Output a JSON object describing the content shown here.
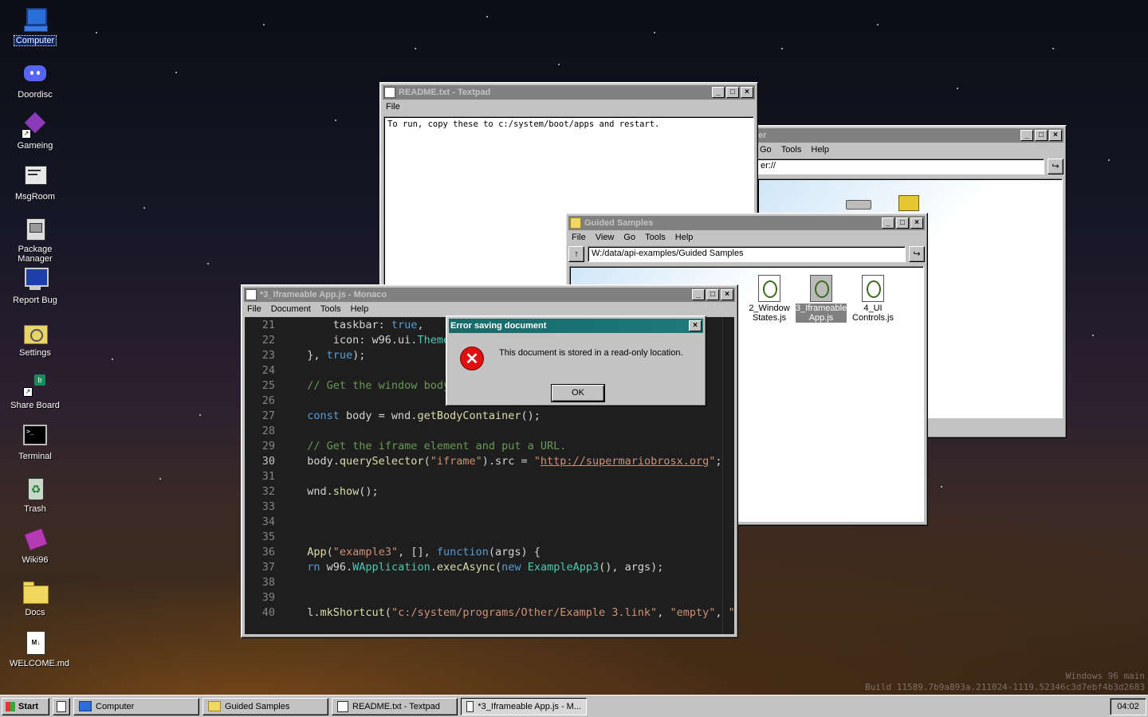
{
  "desktop": {
    "icons": [
      {
        "label": "Computer",
        "icon": "computer-icon"
      },
      {
        "label": "Doordisc",
        "icon": "discord-icon"
      },
      {
        "label": "Gameing",
        "icon": "game-cube-icon"
      },
      {
        "label": "MsgRoom",
        "icon": "chat-icon"
      },
      {
        "label": "Package Manager",
        "icon": "package-icon"
      },
      {
        "label": "Report Bug",
        "icon": "monitor-icon"
      },
      {
        "label": "Settings",
        "icon": "settings-folder-icon"
      },
      {
        "label": "Share Board",
        "icon": "share-icon"
      },
      {
        "label": "Terminal",
        "icon": "terminal-icon"
      },
      {
        "label": "Trash",
        "icon": "recycle-icon"
      },
      {
        "label": "Wiki96",
        "icon": "book-icon"
      },
      {
        "label": "Docs",
        "icon": "folder-icon"
      },
      {
        "label": "WELCOME.md",
        "icon": "markdown-file-icon"
      }
    ],
    "watermark": {
      "line1": "Windows 96 main",
      "line2": "Build 11589.7b9a893a.211024-1119.52346c3d7ebf4b3d2683"
    }
  },
  "readme_window": {
    "title": "README.txt - Textpad",
    "menu": [
      "File"
    ],
    "content": "To run, copy these to c:/system/boot/apps and restart."
  },
  "computer_window": {
    "title_fragment": "er",
    "menu": [
      "Go",
      "Tools",
      "Help"
    ],
    "address": "er://"
  },
  "guided_window": {
    "title": "Guided Samples",
    "menu": [
      "File",
      "View",
      "Go",
      "Tools",
      "Help"
    ],
    "address": "W:/data/api-examples/Guided Samples",
    "files": [
      {
        "label": "2_Window States.js",
        "selected": false
      },
      {
        "label": "3_Iframeable App.js",
        "selected": true
      },
      {
        "label": "4_UI Controls.js",
        "selected": false
      }
    ]
  },
  "editor_window": {
    "title": "*3_Iframeable App.js - Monaco",
    "menu": [
      "File",
      "Document",
      "Tools",
      "Help"
    ]
  },
  "error_dialog": {
    "title": "Error saving document",
    "message": "This document is stored in a read-only location.",
    "ok_label": "OK"
  },
  "taskbar": {
    "start_label": "Start",
    "tasks": [
      "Computer",
      "Guided Samples",
      "README.txt - Textpad",
      "*3_Iframeable App.js - M..."
    ],
    "clock": "04:02"
  },
  "colors": {
    "accent_title": "#0a246a",
    "dialog_title": "#166a6a",
    "window_face": "#c3c3c3"
  }
}
